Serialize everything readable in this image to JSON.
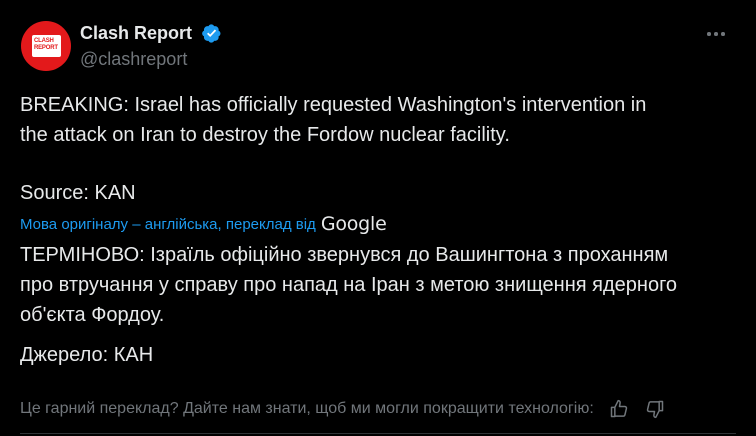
{
  "author": {
    "display_name": "Clash Report",
    "handle": "@clashreport",
    "avatar_text": "CLASH\nREPORT",
    "avatar_color": "#e3191b",
    "verified": true,
    "verified_color": "#1d9bf0"
  },
  "tweet": {
    "original_text": "BREAKING: Israel has officially requested Washington's intervention in\nthe attack on Iran to destroy the Fordow nuclear facility.",
    "original_source": "Source: KAN",
    "translation_note": "Мова оригіналу – англійська, переклад від",
    "translation_provider": "Google",
    "translated_text": "ТЕРМІНОВО: Ізраїль офіційно звернувся до Вашингтона з проханням\nпро втручання у справу про напад на Іран з метою знищення ядерного\nоб'єкта Фордоу.",
    "translated_source": "Джерело: КАН"
  },
  "feedback": {
    "prompt": "Це гарний переклад? Дайте нам знати, щоб ми могли покращити технологію:",
    "thumbs_up_icon": "thumbs-up-icon",
    "thumbs_down_icon": "thumbs-down-icon"
  },
  "icons": {
    "more": "more-options-icon"
  },
  "colors": {
    "background": "#000000",
    "text_primary": "#e7e9ea",
    "text_secondary": "#71767b",
    "link": "#1d9bf0"
  }
}
